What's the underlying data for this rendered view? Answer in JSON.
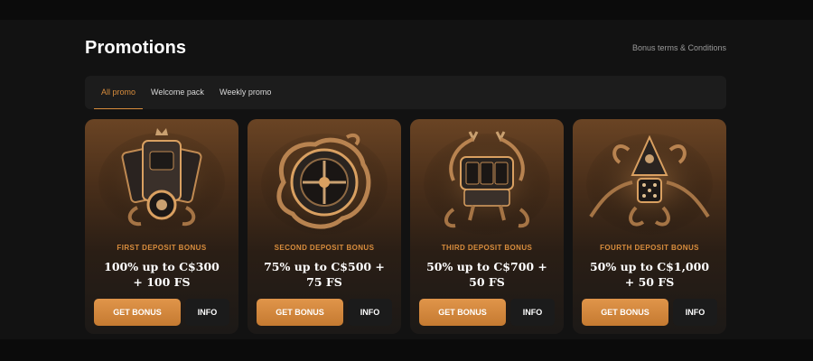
{
  "header": {
    "title": "Promotions",
    "terms_link": "Bonus terms & Conditions"
  },
  "tabs": [
    {
      "label": "All promo",
      "active": true
    },
    {
      "label": "Welcome pack",
      "active": false
    },
    {
      "label": "Weekly promo",
      "active": false
    }
  ],
  "cards": [
    {
      "label": "FIRST DEPOSIT BONUS",
      "offer": "100% up to C$300 + 100 FS",
      "primary_button": "GET BONUS",
      "secondary_button": "INFO",
      "art_icon": "cards-crown-icon"
    },
    {
      "label": "SECOND DEPOSIT BONUS",
      "offer": "75% up to C$500 + 75 FS",
      "primary_button": "GET BONUS",
      "secondary_button": "INFO",
      "art_icon": "roulette-snake-icon"
    },
    {
      "label": "THIRD DEPOSIT BONUS",
      "offer": "50% up to C$700 + 50 FS",
      "primary_button": "GET BONUS",
      "secondary_button": "INFO",
      "art_icon": "slot-machine-icon"
    },
    {
      "label": "FOURTH DEPOSIT BONUS",
      "offer": "50% up to C$1,000 + 50 FS",
      "primary_button": "GET BONUS",
      "secondary_button": "INFO",
      "art_icon": "dice-snake-icon"
    }
  ],
  "colors": {
    "accent": "#d98d3d",
    "background": "#121212",
    "panel": "#1c1c1c"
  }
}
